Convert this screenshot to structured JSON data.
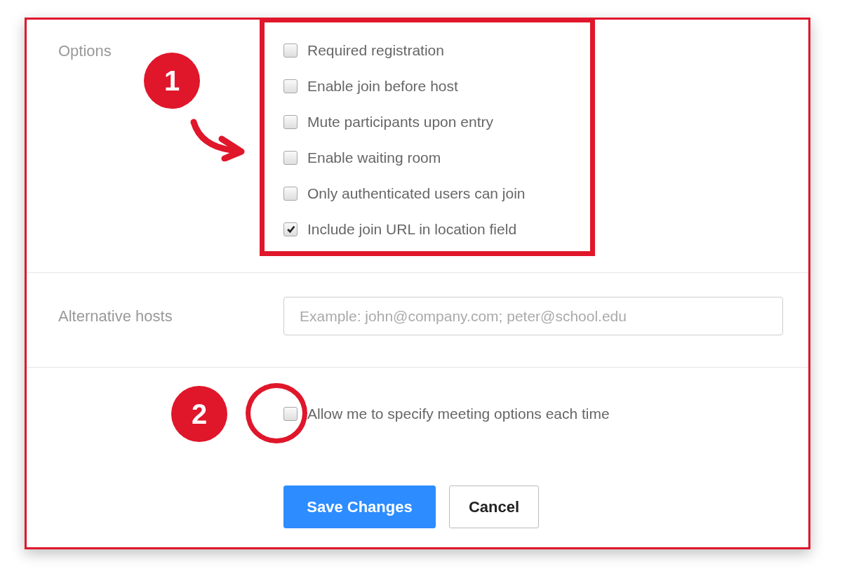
{
  "options": {
    "label": "Options",
    "items": [
      {
        "label": "Required registration",
        "checked": false
      },
      {
        "label": "Enable join before host",
        "checked": false
      },
      {
        "label": "Mute participants upon entry",
        "checked": false
      },
      {
        "label": "Enable waiting room",
        "checked": false
      },
      {
        "label": "Only authenticated users can join",
        "checked": false
      },
      {
        "label": "Include join URL in location field",
        "checked": true
      }
    ]
  },
  "alternative_hosts": {
    "label": "Alternative hosts",
    "placeholder": "Example: john@company.com; peter@school.edu"
  },
  "allow_option": {
    "label": "Allow me to specify meeting options each time",
    "checked": false
  },
  "buttons": [
    {
      "label": "Save Changes",
      "kind": "primary"
    },
    {
      "label": "Cancel",
      "kind": "secondary"
    }
  ],
  "annotations": [
    {
      "number": "1"
    },
    {
      "number": "2"
    }
  ]
}
